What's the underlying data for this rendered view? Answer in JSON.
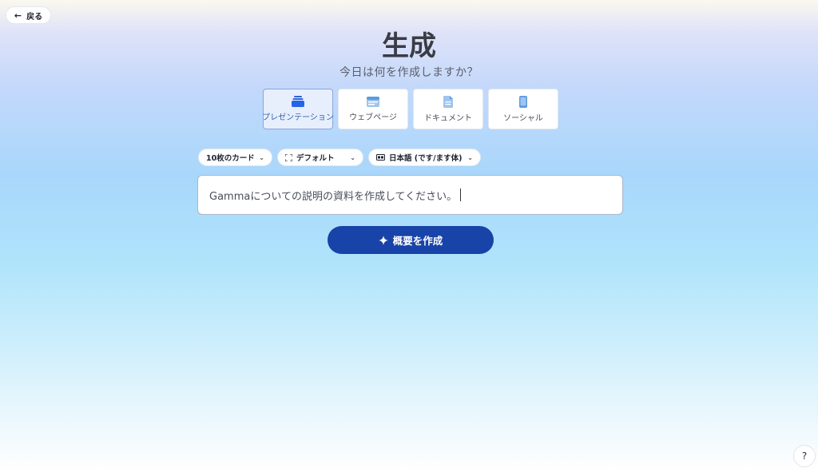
{
  "nav": {
    "back_label": "戻る"
  },
  "header": {
    "title": "生成",
    "subtitle": "今日は何を作成しますか？"
  },
  "types": [
    {
      "label": "プレゼンテーション",
      "icon": "presentation-icon",
      "selected": true
    },
    {
      "label": "ウェブページ",
      "icon": "webpage-icon",
      "selected": false
    },
    {
      "label": "ドキュメント",
      "icon": "document-icon",
      "selected": false
    },
    {
      "label": "ソーシャル",
      "icon": "social-icon",
      "selected": false
    }
  ],
  "selectors": {
    "cards": "10枚のカード",
    "theme": "デフォルト",
    "language": "日本語 (です/ます体)"
  },
  "prompt": {
    "value": "Gammaについての説明の資料を作成してください。"
  },
  "generate": {
    "label": "概要を作成"
  },
  "help": {
    "label": "?"
  },
  "colors": {
    "accent": "#1843a8",
    "selected_bg": "#e7effd",
    "selected_border": "#8aa5da"
  }
}
